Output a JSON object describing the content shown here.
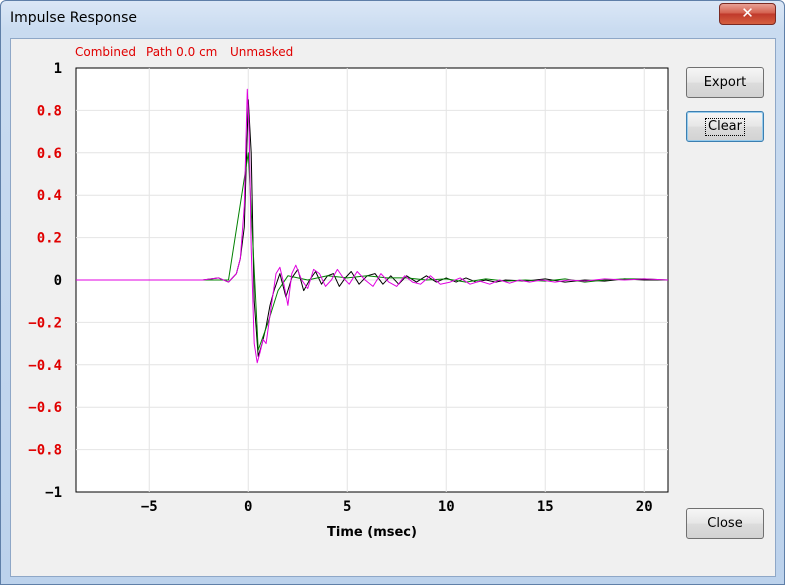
{
  "window": {
    "title": "Impulse Response",
    "close_glyph": "✕"
  },
  "status": {
    "combined": "Combined",
    "path": "Path 0.0 cm",
    "mask": "Unmasked",
    "color": "#e00000"
  },
  "buttons": {
    "export": "Export",
    "clear": "Clear",
    "close": "Close"
  },
  "chart_data": {
    "type": "line",
    "xlabel": "Time (msec)",
    "ylabel": "",
    "xlim": [
      -8.7,
      21.2
    ],
    "ylim": [
      -1,
      1
    ],
    "x_ticks": [
      -5,
      0,
      5,
      10,
      15,
      20
    ],
    "x_tick_labels": [
      "−5",
      "0",
      "5",
      "10",
      "15",
      "20"
    ],
    "y_ticks": [
      1,
      0.8,
      0.6,
      0.4,
      0.2,
      0,
      -0.2,
      -0.4,
      -0.6,
      -0.8,
      -1
    ],
    "y_tick_labels": [
      "1",
      "0.8",
      "0.6",
      "0.4",
      "0.2",
      "0",
      "−0.2",
      "−0.4",
      "−0.6",
      "−0.8",
      "−1"
    ],
    "y_tick_colors": [
      "#000000",
      "#e00000",
      "#e00000",
      "#e00000",
      "#e00000",
      "#000000",
      "#e00000",
      "#e00000",
      "#e00000",
      "#e00000",
      "#000000"
    ],
    "grid": true,
    "series": [
      {
        "color": "#000000",
        "x": [
          -8.7,
          -5,
          -2.3,
          -1.5,
          -1.0,
          -0.6,
          -0.4,
          -0.2,
          0.0,
          0.15,
          0.3,
          0.5,
          0.7,
          0.9,
          1.1,
          1.3,
          1.6,
          1.9,
          2.2,
          2.5,
          2.8,
          3.1,
          3.4,
          3.7,
          4.0,
          4.3,
          4.6,
          4.9,
          5.2,
          5.6,
          6.0,
          6.4,
          6.8,
          7.2,
          7.6,
          8.0,
          8.5,
          9.0,
          9.5,
          10.0,
          10.5,
          11.0,
          11.5,
          12.0,
          12.5,
          13.0,
          14.0,
          15.0,
          16.0,
          17.0,
          18.0,
          19.0,
          20.0,
          21.2
        ],
        "y": [
          0,
          0,
          0,
          0.01,
          -0.01,
          0.03,
          0.1,
          0.25,
          0.85,
          0.6,
          -0.1,
          -0.36,
          -0.3,
          -0.22,
          -0.12,
          -0.05,
          0.03,
          -0.08,
          0.01,
          0.05,
          -0.05,
          0.0,
          0.04,
          -0.02,
          0.02,
          0.03,
          -0.03,
          0.01,
          0.04,
          -0.02,
          0.02,
          0.03,
          -0.02,
          0.02,
          -0.02,
          0.02,
          -0.01,
          0.02,
          -0.01,
          0.01,
          -0.01,
          0.01,
          -0.01,
          0.0,
          -0.01,
          0.0,
          -0.005,
          0.005,
          -0.01,
          0.0,
          -0.005,
          0.005,
          0.0,
          0.0
        ]
      },
      {
        "color": "#008000",
        "x": [
          -8.7,
          -2.3,
          -1.0,
          0.0,
          0.5,
          1.0,
          1.5,
          2.0,
          3.0,
          4.0,
          5.0,
          6.0,
          7.0,
          8.0,
          9.0,
          10.0,
          11.0,
          12.0,
          13.0,
          14.0,
          15.0,
          16.0,
          17.0,
          18.0,
          19.0,
          20.0,
          21.2
        ],
        "y": [
          0,
          0,
          0,
          0.6,
          -0.33,
          -0.2,
          -0.05,
          0.02,
          0.0,
          0.02,
          0.01,
          0.02,
          0.01,
          0.01,
          0.0,
          0.005,
          -0.01,
          0.005,
          -0.005,
          0.0,
          -0.005,
          0.005,
          -0.01,
          0.0,
          0.005,
          0.005,
          0.0
        ]
      },
      {
        "color": "#e000e0",
        "x": [
          -8.7,
          -5,
          -2.3,
          -1.5,
          -1.0,
          -0.6,
          -0.4,
          -0.2,
          -0.05,
          0.05,
          0.15,
          0.3,
          0.45,
          0.6,
          0.75,
          0.9,
          1.05,
          1.2,
          1.4,
          1.6,
          1.8,
          2.0,
          2.2,
          2.4,
          2.7,
          3.0,
          3.3,
          3.6,
          3.9,
          4.2,
          4.5,
          4.8,
          5.1,
          5.5,
          5.9,
          6.3,
          6.7,
          7.1,
          7.5,
          7.9,
          8.3,
          8.7,
          9.2,
          9.7,
          10.2,
          10.7,
          11.2,
          11.7,
          12.2,
          12.7,
          13.2,
          13.7,
          14.2,
          14.8,
          15.5,
          16.2,
          17.0,
          18.0,
          19.0,
          20.0,
          21.2
        ],
        "y": [
          0,
          0,
          0,
          0.01,
          -0.01,
          0.03,
          0.1,
          0.35,
          0.9,
          0.7,
          0.15,
          -0.3,
          -0.39,
          -0.34,
          -0.28,
          -0.3,
          -0.2,
          -0.1,
          0.03,
          0.06,
          -0.02,
          -0.12,
          0.03,
          0.07,
          0.0,
          -0.04,
          0.05,
          0.03,
          -0.03,
          0.0,
          0.05,
          0.01,
          -0.02,
          0.04,
          0.0,
          -0.03,
          0.03,
          -0.01,
          -0.03,
          0.02,
          -0.01,
          -0.02,
          0.02,
          -0.02,
          -0.01,
          0.01,
          -0.02,
          -0.005,
          -0.02,
          0.0,
          -0.015,
          0.0,
          -0.01,
          0.0,
          -0.01,
          0.0,
          -0.005,
          0.005,
          0.0,
          0.005,
          0.0
        ]
      }
    ]
  }
}
